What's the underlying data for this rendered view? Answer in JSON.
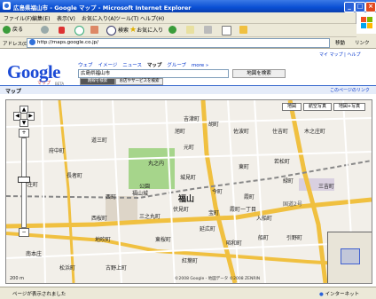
{
  "window": {
    "title": "広島県福山市 - Google マップ - Microsoft Internet Explorer"
  },
  "menu": {
    "items": [
      "ファイル(F)",
      "編集(E)",
      "表示(V)",
      "お気に入り(A)",
      "ツール(T)",
      "ヘルプ(H)"
    ]
  },
  "toolbar": {
    "back": "戻る",
    "search": "検索",
    "favorites": "お気に入り"
  },
  "address": {
    "label": "アドレス(D)",
    "url": "http://maps.google.co.jp/",
    "go": "移動",
    "links": "リンク"
  },
  "google": {
    "logo": "Google",
    "logo_sub": "マップ",
    "beta": "BETA",
    "top_right": "マイ マップ | ヘルプ",
    "nav": [
      "ウェブ",
      "イメージ",
      "ニュース",
      "マップ",
      "グループ",
      "more »"
    ],
    "search_value": "広島県福山市",
    "search_button": "地図を検索",
    "sub_left": "マップ",
    "sub_tab1": "路線を検索",
    "sub_tab2": "お店やサービスを検索",
    "sub_right": "このページのリンク"
  },
  "map": {
    "type_buttons": [
      "地図",
      "航空写真",
      "地図+写真"
    ],
    "labels": [
      "胡町",
      "旭町",
      "吉津町",
      "佐波町",
      "住吉町",
      "木之庄町",
      "元町",
      "長者町",
      "丸之内",
      "福山",
      "伏見町",
      "今町",
      "霞町",
      "延広町",
      "昭和町",
      "宝町",
      "東桜町",
      "西町",
      "南本庄",
      "城見町",
      "入船町",
      "引野町",
      "東町",
      "若松町",
      "三吉町",
      "紅葉町",
      "公園",
      "福山城",
      "国道2号",
      "道三町",
      "緑町",
      "古野上町",
      "府中町",
      "三之丸町",
      "西桜町",
      "船町",
      "霞町一丁目",
      "地吹町",
      "松浜町",
      "本庄町"
    ],
    "copyright": "©2008 Google - 地図データ ©2008 ZENRIN",
    "scale": "200 m"
  },
  "status": {
    "text": "ページが表示されました",
    "zone": "インターネット"
  }
}
